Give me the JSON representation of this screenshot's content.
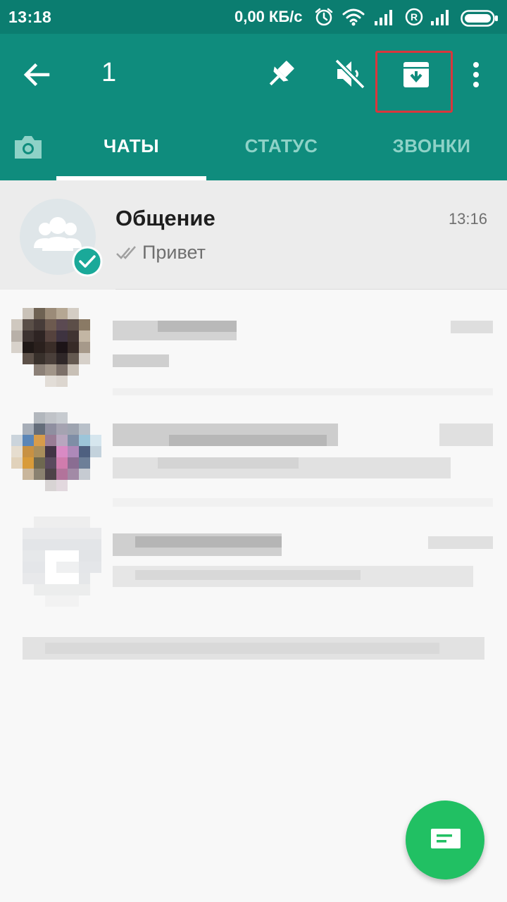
{
  "status_bar": {
    "time": "13:18",
    "network_speed": "0,00 КБ/с"
  },
  "toolbar": {
    "selected_count": "1",
    "icons": [
      "back-arrow-icon",
      "pin-icon",
      "mute-icon",
      "archive-icon",
      "more-vert-icon"
    ],
    "highlight_color": "#d9363c"
  },
  "tabs": [
    {
      "label": "ЧАТЫ",
      "active": true
    },
    {
      "label": "СТАТУС",
      "active": false
    },
    {
      "label": "ЗВОНКИ",
      "active": false
    }
  ],
  "chats": [
    {
      "name": "Общение",
      "time": "13:16",
      "message": "Привет",
      "selected": true
    }
  ],
  "colors": {
    "header": "#0f8c7d",
    "status_bar": "#0b7d70",
    "fab": "#21c063",
    "selected_row": "#ececec",
    "check_badge": "#1aa999"
  }
}
